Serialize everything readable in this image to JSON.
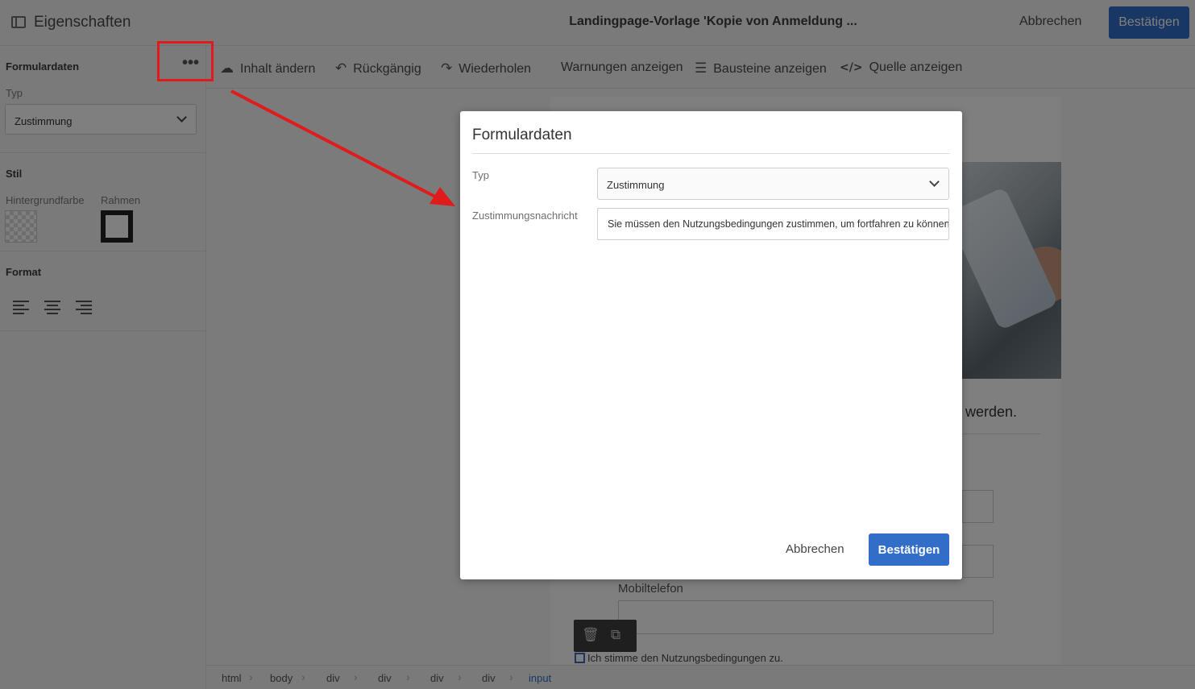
{
  "topbar": {
    "title": "Eigenschaften",
    "document_title": "Landingpage-Vorlage 'Kopie von Anmeldung ...",
    "cancel_label": "Abbrechen",
    "confirm_label": "Bestätigen"
  },
  "sidebar": {
    "heading": "Formulardaten",
    "more_icon": "more-horizontal-icon",
    "type_label": "Typ",
    "type_value": "Zustimmung",
    "style_heading": "Stil",
    "background_label": "Hintergrundfarbe",
    "border_label": "Rahmen",
    "format_heading": "Format"
  },
  "toolbar": {
    "change_content": "Inhalt ändern",
    "undo": "Rückgängig",
    "redo": "Wiederholen",
    "show_warnings": "Warnungen anzeigen",
    "show_blocks": "Bausteine anzeigen",
    "show_source": "Quelle anzeigen"
  },
  "page": {
    "heading_fragment": "werden.",
    "mobile_label": "Mobiltelefon",
    "consent_text": "Ich stimme den Nutzungsbedingungen zu."
  },
  "breadcrumb": [
    "html",
    "body",
    "div",
    "div",
    "div",
    "div",
    "input"
  ],
  "modal": {
    "title": "Formulardaten",
    "type_label": "Typ",
    "type_value": "Zustimmung",
    "consent_message_label": "Zustimmungsnachricht",
    "consent_message_value": "Sie müssen den Nutzungsbedingungen zustimmen, um fortfahren zu können.",
    "cancel_label": "Abbrechen",
    "confirm_label": "Bestätigen"
  },
  "colors": {
    "accent": "#326ec8",
    "annotation": "#e01b1b"
  }
}
